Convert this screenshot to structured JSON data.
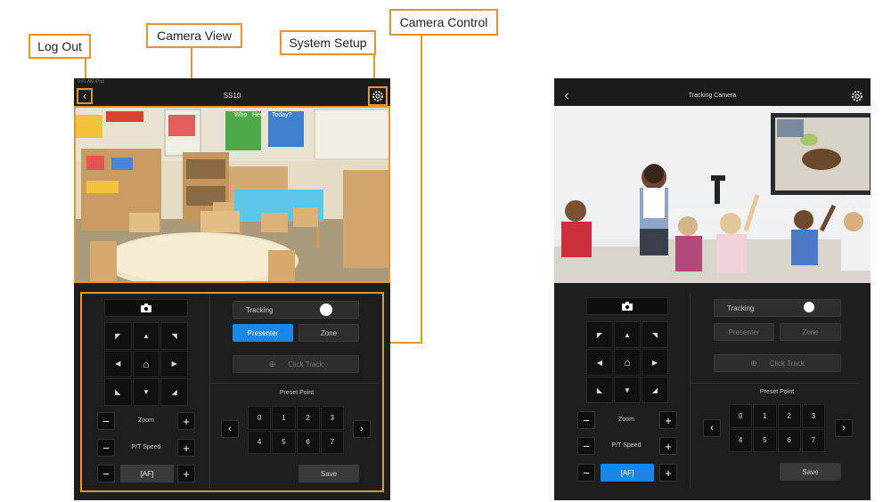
{
  "callouts": {
    "log_out": "Log Out",
    "camera_view": "Camera View",
    "system_setup": "System Setup",
    "camera_control": "Camera Control"
  },
  "left_app": {
    "status": "9:41 AM  iPad",
    "title": "SS10",
    "tracking_label": "Tracking",
    "presenter": "Presenter",
    "zone": "Zone",
    "click_track": "Click Track",
    "preset_title": "Preset Point",
    "presets": [
      "0",
      "1",
      "2",
      "3",
      "4",
      "5",
      "6",
      "7"
    ],
    "save": "Save",
    "zoom": "Zoom",
    "pt_speed": "P/T Speed",
    "af": "[AF]",
    "classroom_signs": [
      "Who",
      "Here",
      "Today?"
    ]
  },
  "right_app": {
    "title": "Tracking Camera",
    "tracking_label": "Tracking",
    "presenter": "Presenter",
    "zone": "Zone",
    "click_track": "Click Track",
    "preset_title": "Preset Point",
    "presets": [
      "0",
      "1",
      "2",
      "3",
      "4",
      "5",
      "6",
      "7"
    ],
    "save": "Save",
    "zoom": "Zoom",
    "pt_speed": "P/T Speed",
    "af": "[AF]"
  },
  "colors": {
    "accent": "#e8952b",
    "blue": "#1a87e6",
    "panel": "#1c1c1c"
  }
}
